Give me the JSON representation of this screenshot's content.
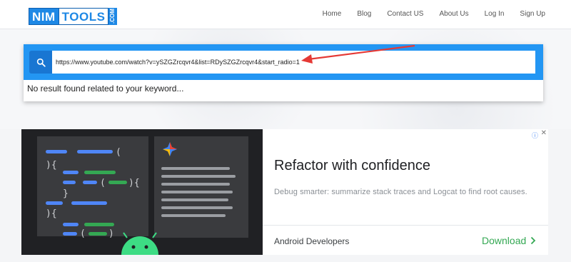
{
  "logo": {
    "part1": "NIM",
    "part2": "TOOLS",
    "suffix": ".COM"
  },
  "nav": [
    "Home",
    "Blog",
    "Contact US",
    "About Us",
    "Log In",
    "Sign Up"
  ],
  "search": {
    "value": "https://www.youtube.com/watch?v=ySZGZrcqvr4&list=RDySZGZrcqvr4&start_radio=1",
    "icon": "search-icon"
  },
  "result_message": "No result found related to your keyword...",
  "ad": {
    "title": "Refactor with confidence",
    "description": "Debug smarter: summarize stack traces and Logcat to find root causes.",
    "advertiser": "Android Developers",
    "cta": "Download",
    "info_icon": "info-icon",
    "close_icon": "close-icon"
  },
  "colors": {
    "accent": "#2396f3",
    "accent_dark": "#1976d2",
    "arrow": "#e53935",
    "cta_green": "#34a853"
  }
}
